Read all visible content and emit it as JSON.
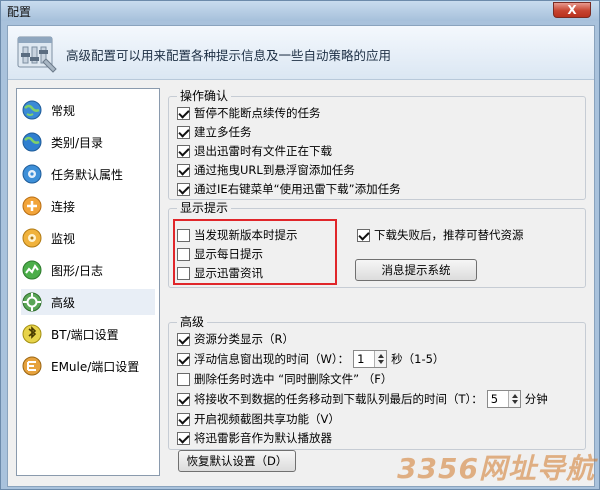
{
  "window": {
    "title": "配置",
    "close_label": "X"
  },
  "banner": {
    "text": "高级配置可以用来配置各种提示信息及一些自动策略的应用"
  },
  "nav": {
    "items": [
      {
        "label": "常规",
        "icon": "globe-icon"
      },
      {
        "label": "类别/目录",
        "icon": "globe-icon"
      },
      {
        "label": "任务默认属性",
        "icon": "gear-icon"
      },
      {
        "label": "连接",
        "icon": "connection-icon"
      },
      {
        "label": "监视",
        "icon": "monitor-icon"
      },
      {
        "label": "图形/日志",
        "icon": "chart-icon"
      },
      {
        "label": "高级",
        "icon": "advanced-gear-icon"
      },
      {
        "label": "BT/端口设置",
        "icon": "bt-icon"
      },
      {
        "label": "EMule/端口设置",
        "icon": "emule-icon"
      }
    ],
    "active_index": 6
  },
  "groups": {
    "operation": {
      "title": "操作确认",
      "items": [
        {
          "label": "暂停不能断点续传的任务",
          "checked": true
        },
        {
          "label": "建立多任务",
          "checked": true
        },
        {
          "label": "退出迅雷时有文件正在下载",
          "checked": true
        },
        {
          "label": "通过拖曳URL到悬浮窗添加任务",
          "checked": true
        },
        {
          "label": "通过IE右键菜单“使用迅雷下载”添加任务",
          "checked": true
        }
      ]
    },
    "display": {
      "title": "显示提示",
      "items": [
        {
          "label": "当发现新版本时提示",
          "checked": false
        },
        {
          "label": "显示每日提示",
          "checked": false
        },
        {
          "label": "显示迅雷资讯",
          "checked": false
        }
      ],
      "right_check": {
        "label": "下载失败后，推荐可替代资源",
        "checked": true
      },
      "message_button": "消息提示系统"
    },
    "advanced": {
      "title": "高级",
      "items": [
        {
          "label": "资源分类显示（R）",
          "checked": true
        },
        {
          "label": "浮动信息窗出现的时间（W）：",
          "checked": true,
          "spin_value": "1",
          "suffix": "秒（1-5）"
        },
        {
          "label": "删除任务时选中 “同时删除文件” （F）",
          "checked": false
        },
        {
          "label": "将接收不到数据的任务移动到下载队列最后的时间（T）：",
          "checked": true,
          "spin_value": "5",
          "suffix": "分钟"
        },
        {
          "label": "开启视频截图共享功能（V）",
          "checked": true
        },
        {
          "label": "将迅雷影音作为默认播放器",
          "checked": true
        }
      ],
      "restore_button": "恢复默认设置（D）"
    }
  },
  "watermark": {
    "text": "3356网址导航"
  }
}
